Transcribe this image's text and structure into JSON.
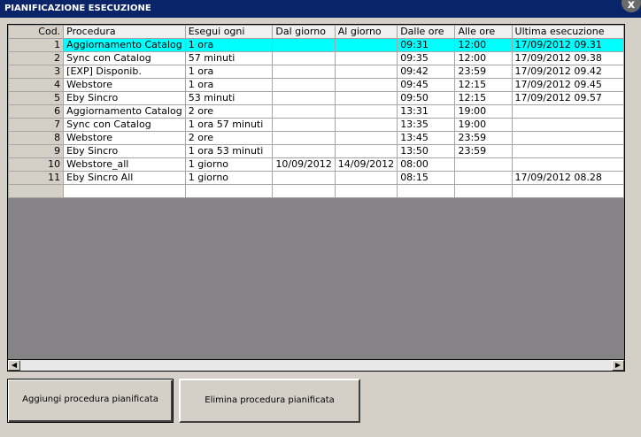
{
  "window": {
    "title": "PIANIFICAZIONE ESECUZIONE",
    "close_glyph": "x"
  },
  "table": {
    "columns": [
      "Cod.",
      "Procedura",
      "Esegui ogni",
      "Dal giorno",
      "Al giorno",
      "Dalle ore",
      "Alle ore",
      "Ultima esecuzione"
    ],
    "rows": [
      [
        "1",
        "Aggiornamento Catalog",
        "1 ora",
        "",
        "",
        "09:31",
        "12:00",
        "17/09/2012 09.31"
      ],
      [
        "2",
        "Sync con Catalog",
        "57 minuti",
        "",
        "",
        "09:35",
        "12:00",
        "17/09/2012 09.38"
      ],
      [
        "3",
        "[EXP] Disponib.",
        "1 ora",
        "",
        "",
        "09:42",
        "23:59",
        "17/09/2012 09.42"
      ],
      [
        "4",
        "Webstore",
        "1 ora",
        "",
        "",
        "09:45",
        "12:15",
        "17/09/2012 09.45"
      ],
      [
        "5",
        "Eby Sincro",
        "53 minuti",
        "",
        "",
        "09:50",
        "12:15",
        "17/09/2012 09.57"
      ],
      [
        "6",
        "Aggiornamento Catalog",
        "2 ore",
        "",
        "",
        "13:31",
        "19:00",
        ""
      ],
      [
        "7",
        "Sync con Catalog",
        "1 ora 57 minuti",
        "",
        "",
        "13:35",
        "19:00",
        ""
      ],
      [
        "8",
        "Webstore",
        "2 ore",
        "",
        "",
        "13:45",
        "23:59",
        ""
      ],
      [
        "9",
        "Eby Sincro",
        "1 ora 53 minuti",
        "",
        "",
        "13:50",
        "23:59",
        ""
      ],
      [
        "10",
        "Webstore_all",
        "1 giorno",
        "10/09/2012",
        "14/09/2012",
        "08:00",
        "",
        ""
      ],
      [
        "11",
        "Eby Sincro All",
        "1 giorno",
        "",
        "",
        "08:15",
        "",
        "17/09/2012 08.28"
      ],
      [
        "",
        "",
        "",
        "",
        "",
        "",
        "",
        ""
      ]
    ],
    "selected_row": 0
  },
  "scrollbar": {
    "left_glyph": "◀",
    "right_glyph": "▶"
  },
  "buttons": {
    "add_label": "Aggiungi procedura pianificata",
    "delete_label": "Elimina procedura pianificata"
  }
}
